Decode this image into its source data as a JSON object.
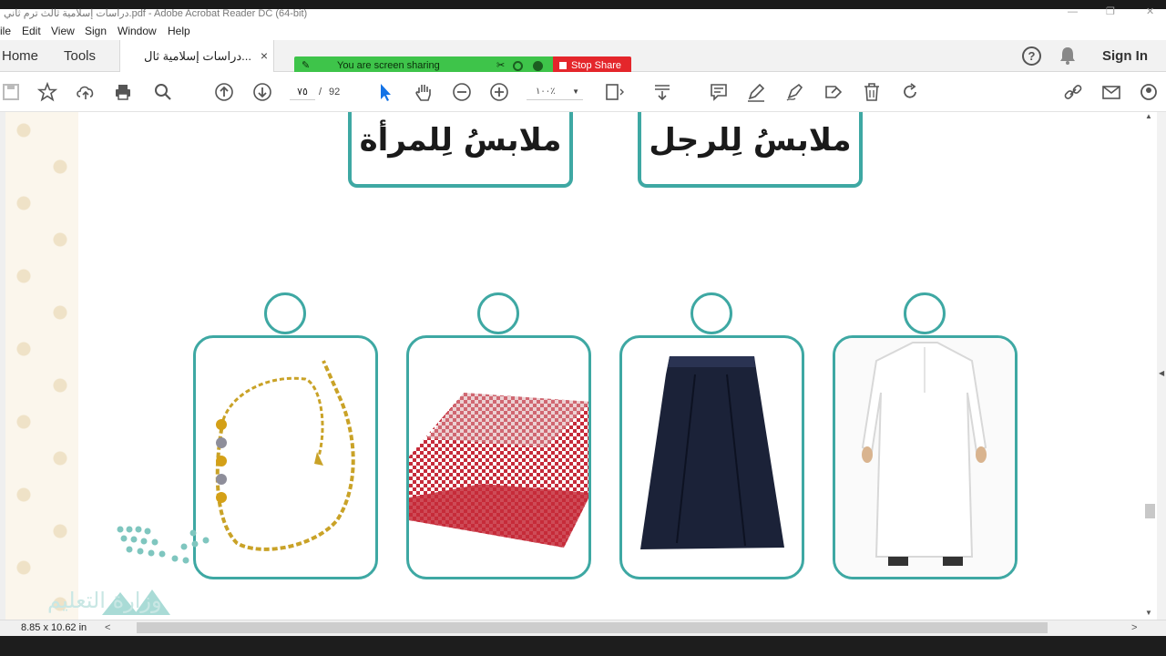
{
  "window": {
    "title": "دراسات إسلامية ثالث ترم ثاني.pdf - Adobe Acrobat Reader DC (64-bit)"
  },
  "menu": [
    "ile",
    "Edit",
    "View",
    "Sign",
    "Window",
    "Help"
  ],
  "tabs": {
    "home": "Home",
    "tools": "Tools",
    "document": "دراسات إسلامية ثال...",
    "close": "×"
  },
  "header_right": {
    "sign_in": "Sign In"
  },
  "screen_share": {
    "status": "You are screen sharing",
    "stop": "Stop Share"
  },
  "toolbar": {
    "page_current": "٧٥",
    "page_separator": "/",
    "page_total": "92",
    "zoom": "١٠٠٪"
  },
  "document": {
    "headings": {
      "women": "ملابسُ لِلمرأة",
      "men": "ملابسُ لِلرجل"
    },
    "logo_text": "وزارة التعليم",
    "cards": [
      {
        "item": "gold bracelet"
      },
      {
        "item": "red shemagh"
      },
      {
        "item": "navy skirt"
      },
      {
        "item": "white thobe"
      }
    ]
  },
  "status": {
    "page_size": "8.85 x 10.62 in"
  },
  "colors": {
    "accent_teal": "#3ea8a3",
    "share_green": "#3ec44a",
    "stop_red": "#e4262b",
    "acrobat_blue": "#1473e6"
  }
}
